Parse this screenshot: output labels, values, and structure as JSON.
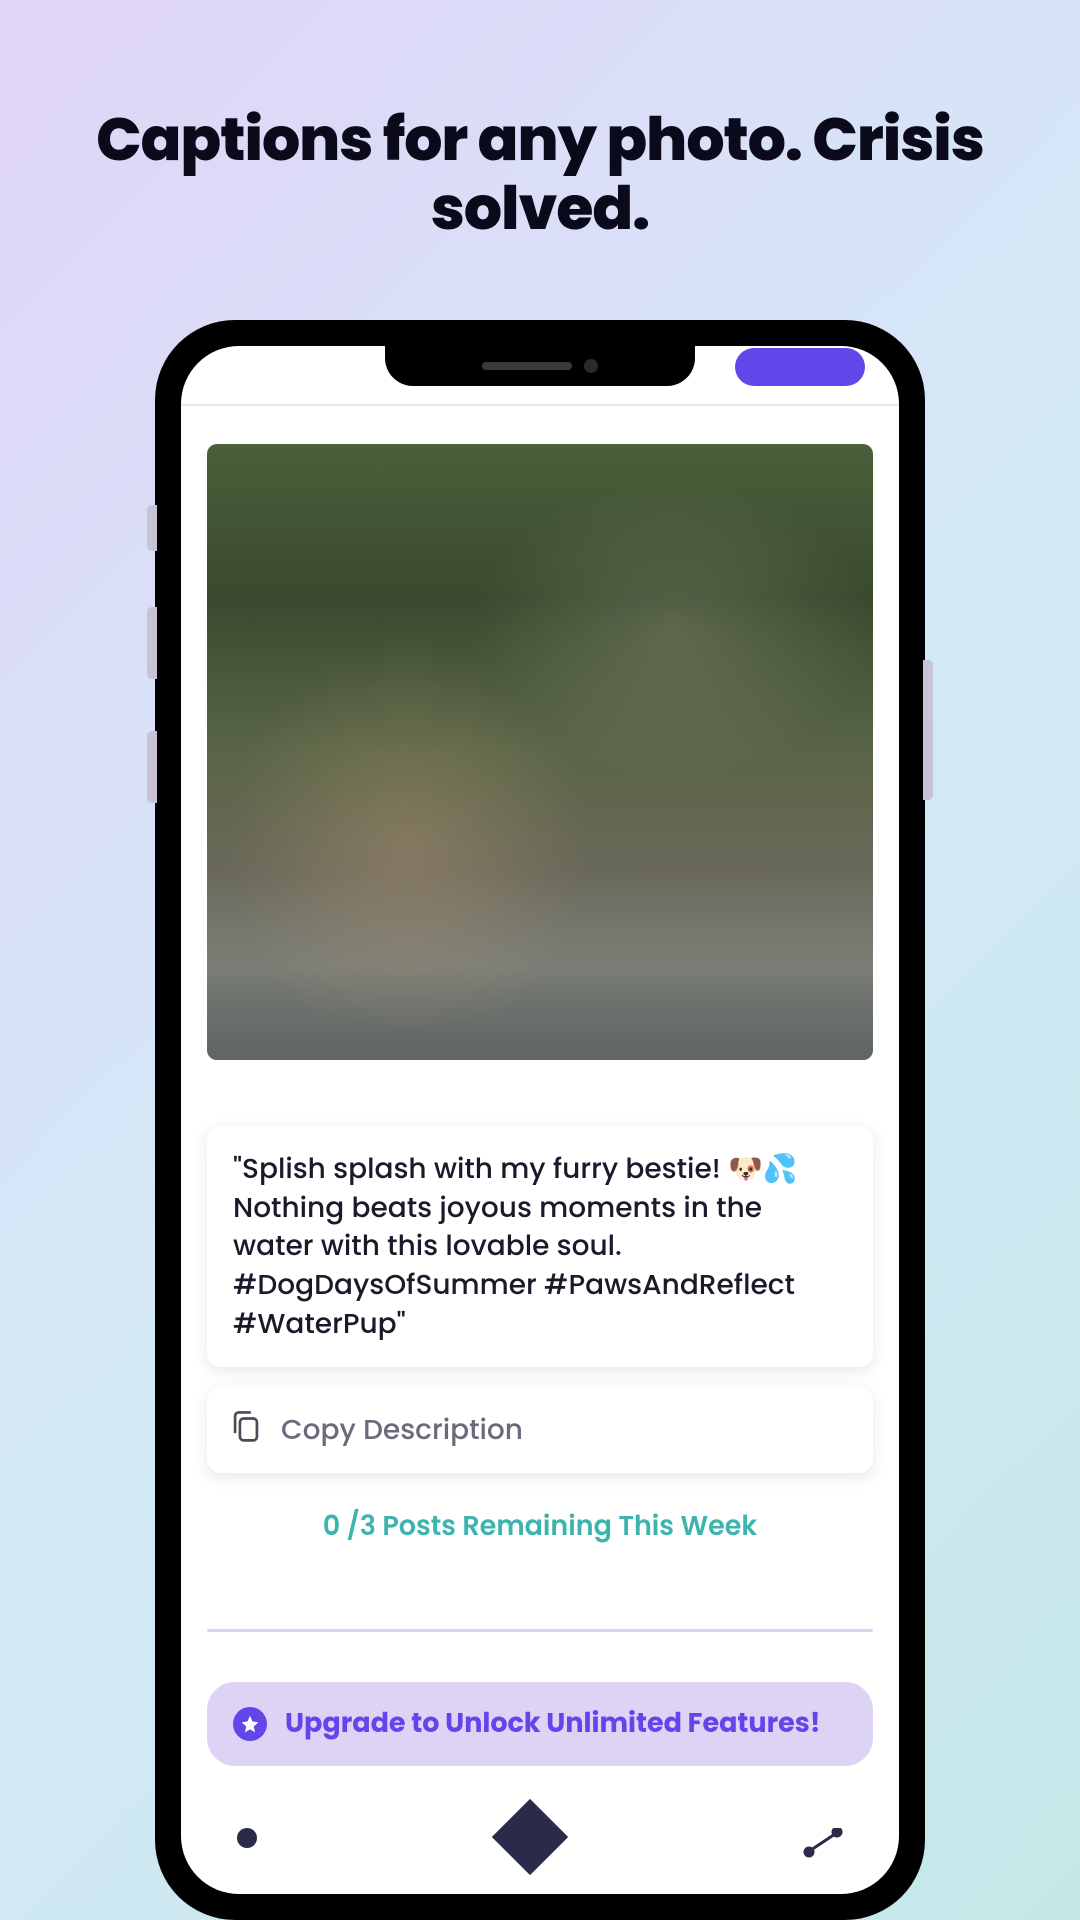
{
  "headline": "Captions for any photo. Crisis solved.",
  "caption_text": "\"Splish splash with my furry bestie! 🐶💦 Nothing beats joyous moments in the water with this lovable soul. #DogDaysOfSummer #PawsAndReflect #WaterPup\"",
  "copy_label": "Copy Description",
  "remaining_text": "0 /3 Posts Remaining This Week",
  "upgrade_text": "Upgrade to Unlock Unlimited Features!",
  "colors": {
    "accent": "#6246ea",
    "teal": "#3db5ae",
    "banner_bg": "#dcd3f5"
  }
}
